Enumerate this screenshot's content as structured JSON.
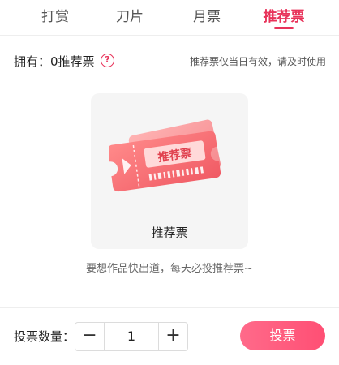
{
  "tabs": [
    {
      "label": "打赏"
    },
    {
      "label": "刀片"
    },
    {
      "label": "月票"
    },
    {
      "label": "推荐票",
      "active": true
    }
  ],
  "owned_text": "拥有：0推荐票",
  "help_symbol": "?",
  "notice": "推荐票仅当日有效，请及时使用",
  "card": {
    "ticket_text": "推荐票",
    "label": "推荐票"
  },
  "slogan": "要想作品快出道，每天必投推荐票~",
  "footer": {
    "quantity_label": "投票数量：",
    "minus": "−",
    "quantity": "1",
    "plus": "+",
    "vote_button": "投票"
  },
  "colors": {
    "accent": "#e8335a",
    "vote_button": "#ff5a7c"
  }
}
